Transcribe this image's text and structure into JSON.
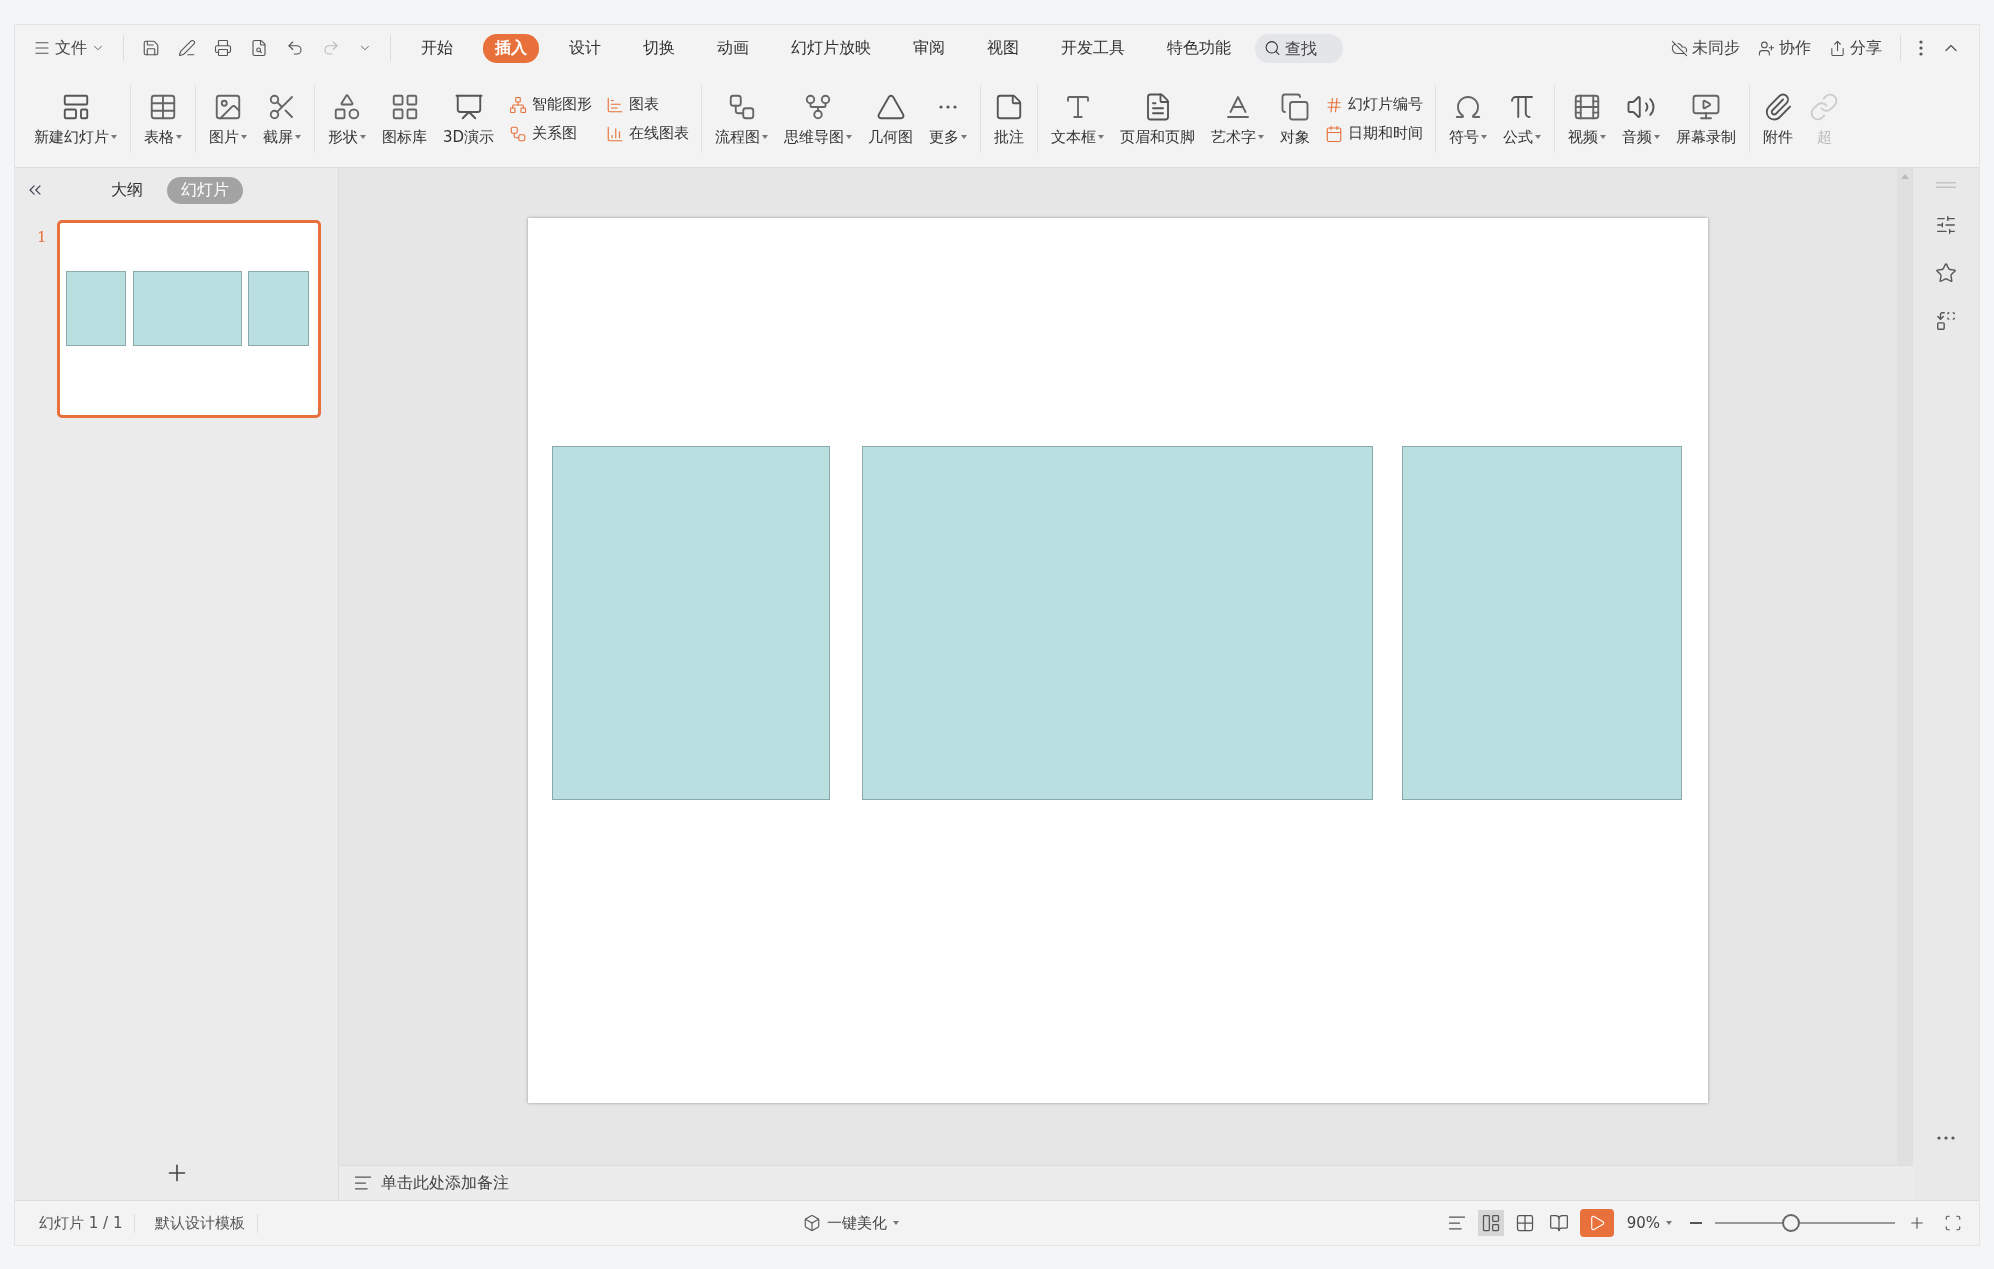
{
  "menu": {
    "file_label": "文件",
    "tabs": [
      {
        "label": "开始",
        "selected": false
      },
      {
        "label": "插入",
        "selected": true
      },
      {
        "label": "设计",
        "selected": false
      },
      {
        "label": "切换",
        "selected": false
      },
      {
        "label": "动画",
        "selected": false
      },
      {
        "label": "幻灯片放映",
        "selected": false
      },
      {
        "label": "审阅",
        "selected": false
      },
      {
        "label": "视图",
        "selected": false
      },
      {
        "label": "开发工具",
        "selected": false
      },
      {
        "label": "特色功能",
        "selected": false
      }
    ],
    "search": {
      "placeholder": "查找"
    },
    "actions": [
      "未同步",
      "协作",
      "分享"
    ]
  },
  "ribbon": [
    {
      "kind": "large",
      "label": "新建幻灯片",
      "dropdown": true
    },
    {
      "kind": "separator"
    },
    {
      "kind": "large",
      "label": "表格",
      "dropdown": true
    },
    {
      "kind": "separator"
    },
    {
      "kind": "large",
      "label": "图片",
      "dropdown": true
    },
    {
      "kind": "large",
      "label": "截屏",
      "dropdown": true
    },
    {
      "kind": "separator"
    },
    {
      "kind": "large",
      "label": "形状",
      "dropdown": true
    },
    {
      "kind": "large",
      "label": "图标库",
      "dropdown": false
    },
    {
      "kind": "large",
      "label": "3D演示",
      "dropdown": false
    },
    {
      "kind": "pair",
      "items": [
        "智能图形",
        "关系图"
      ]
    },
    {
      "kind": "pair",
      "items": [
        "图表",
        "在线图表"
      ]
    },
    {
      "kind": "separator"
    },
    {
      "kind": "large",
      "label": "流程图",
      "dropdown": true
    },
    {
      "kind": "large",
      "label": "思维导图",
      "dropdown": true
    },
    {
      "kind": "large",
      "label": "几何图",
      "dropdown": false
    },
    {
      "kind": "large",
      "label": "更多",
      "dropdown": true
    },
    {
      "kind": "separator"
    },
    {
      "kind": "large",
      "label": "批注",
      "dropdown": false
    },
    {
      "kind": "separator"
    },
    {
      "kind": "large",
      "label": "文本框",
      "dropdown": true
    },
    {
      "kind": "large",
      "label": "页眉和页脚",
      "dropdown": false
    },
    {
      "kind": "large",
      "label": "艺术字",
      "dropdown": true
    },
    {
      "kind": "large",
      "label": "对象",
      "dropdown": false
    },
    {
      "kind": "pair",
      "items": [
        "幻灯片编号",
        "日期和时间"
      ]
    },
    {
      "kind": "separator"
    },
    {
      "kind": "large",
      "label": "符号",
      "dropdown": true
    },
    {
      "kind": "large",
      "label": "公式",
      "dropdown": true
    },
    {
      "kind": "separator"
    },
    {
      "kind": "large",
      "label": "视频",
      "dropdown": true
    },
    {
      "kind": "large",
      "label": "音频",
      "dropdown": true
    },
    {
      "kind": "large",
      "label": "屏幕录制",
      "dropdown": false
    },
    {
      "kind": "separator"
    },
    {
      "kind": "large",
      "label": "附件",
      "dropdown": false
    },
    {
      "kind": "faded",
      "label": "超",
      "dropdown": false
    }
  ],
  "panel": {
    "tabs": [
      {
        "label": "大纲",
        "selected": false
      },
      {
        "label": "幻灯片",
        "selected": true
      }
    ],
    "slides": [
      {
        "number": "1",
        "selected": true
      }
    ]
  },
  "notes_prompt": "单击此处添加备注",
  "status": {
    "slide_info": "幻灯片 1 / 1",
    "template": "默认设计模板",
    "beautify": "一键美化",
    "zoom": "90%",
    "zoom_slider": {
      "level": 0.42
    }
  }
}
